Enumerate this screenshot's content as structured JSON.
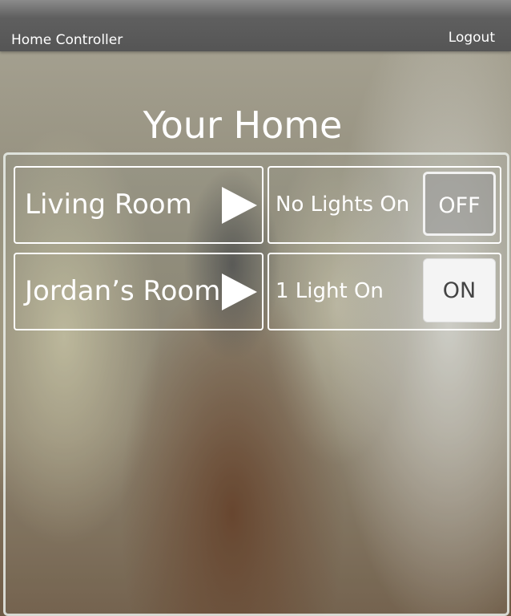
{
  "header": {
    "app_title": "Home Controller",
    "logout_label": "Logout"
  },
  "page": {
    "title": "Your Home"
  },
  "rooms": [
    {
      "name": "Living Room",
      "status": "No Lights On",
      "toggle_label": "OFF",
      "toggle_state": "off"
    },
    {
      "name": "Jordan’s Room",
      "status": "1 Light On",
      "toggle_label": "ON",
      "toggle_state": "on"
    }
  ],
  "icons": {
    "room_arrow": "play-icon"
  },
  "colors": {
    "topbar": "#5f5f5f",
    "on_button": "#f4f4f4",
    "on_text": "#444444"
  }
}
